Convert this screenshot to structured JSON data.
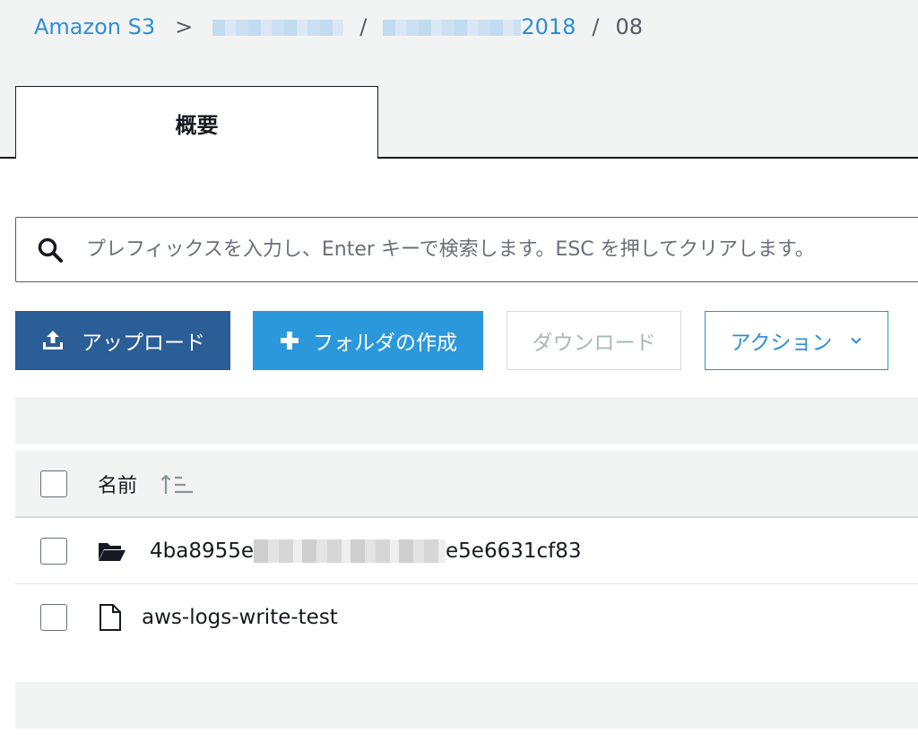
{
  "breadcrumb": {
    "root": "Amazon S3",
    "separator": ">",
    "slash": "/",
    "bucket_suffix": "2018",
    "current": "08"
  },
  "tabs": [
    {
      "label": "概要"
    }
  ],
  "search": {
    "placeholder": "プレフィックスを入力し、Enter キーで検索します。ESC を押してクリアします。"
  },
  "toolbar": {
    "upload_label": "アップロード",
    "create_folder_label": "フォルダの作成",
    "download_label": "ダウンロード",
    "actions_label": "アクション"
  },
  "table": {
    "columns": [
      "名前"
    ],
    "rows": [
      {
        "type": "folder",
        "name_prefix": "4ba8955e",
        "name_suffix": "e5e6631cf83"
      },
      {
        "type": "file",
        "name": "aws-logs-write-test"
      }
    ]
  },
  "colors": {
    "link": "#2d8ed6",
    "upload_button": "#2b5d96",
    "create_folder_button": "#2b98dc"
  }
}
